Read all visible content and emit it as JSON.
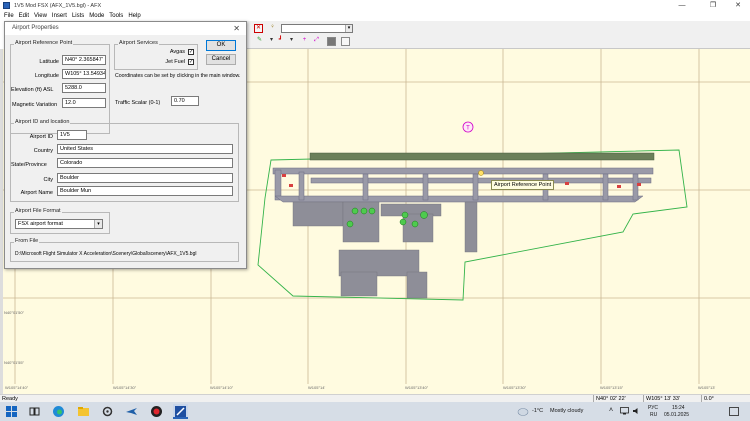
{
  "window": {
    "title": "1V5 Mod FSX (AFX_1V5.bgl) - AFX"
  },
  "menu": [
    "File",
    "Edit",
    "View",
    "Insert",
    "Lists",
    "Mode",
    "Tools",
    "Help"
  ],
  "dialog": {
    "title": "Airport Properties",
    "arp_group": "Airport Reference Point",
    "latitude_label": "Latitude",
    "latitude_value": "N40° 2.365847'",
    "longitude_label": "Longitude",
    "longitude_value": "W105° 13.54934",
    "elevation_label": "Elevation (ft) ASL",
    "elevation_value": "5288.0",
    "magvar_label": "Magnetic Variation",
    "magvar_value": "12.0",
    "services_group": "Airport Services",
    "avgas_label": "Avgas",
    "jetfuel_label": "Jet Fuel",
    "ok_label": "OK",
    "cancel_label": "Cancel",
    "coords_hint": "Coordinates can be set by clicking in the main window.",
    "traffic_label": "Traffic Scalar (0-1)",
    "traffic_value": "0.70",
    "id_group": "Airport ID and location",
    "id_label": "Airport ID",
    "id_value": "1V5",
    "country_label": "Country",
    "country_value": "United States",
    "state_label": "State/Province",
    "state_value": "Colorado",
    "city_label": "City",
    "city_value": "Boulder",
    "name_label": "Airport Name",
    "name_value": "Boulder Mun",
    "format_group": "Airport File Format",
    "format_value": "FSX airport format",
    "from_group": "From File",
    "from_value": "D:\\Microsoft Flight Simulator X Acceleration\\Scenery\\Global\\scenery\\AFX_1V5.bgl"
  },
  "map": {
    "arp_tooltip": "Airport Reference Point",
    "tower_symbol": "T",
    "lat_ticks": [
      "N40°02'22\"",
      "N40°01'50\"",
      "N40°01'55\""
    ],
    "lon_ticks": [
      "W105°14'40\"",
      "W105°14'30\"",
      "W105°14'10\"",
      "W105°14'",
      "W105°13'40\"",
      "W105°13'30\"",
      "W105°13'15\"",
      "W105°13'"
    ]
  },
  "statusbar": {
    "left": "Ready",
    "lat": "N40° 02' 22'",
    "lon": "W105° 13' 33'",
    "heading": "0.0°"
  },
  "taskbar": {
    "weather_temp": "-1°C",
    "weather_text": "Mostly cloudy",
    "lang_top": "РУС",
    "lang_bottom": "RU",
    "time": "15:24",
    "date": "05.01.2025"
  },
  "colors": {
    "accent": "#0078d7",
    "map_bg": "#fffbe0",
    "map_grid": "#c8b48c",
    "boundary": "#34b34a"
  }
}
